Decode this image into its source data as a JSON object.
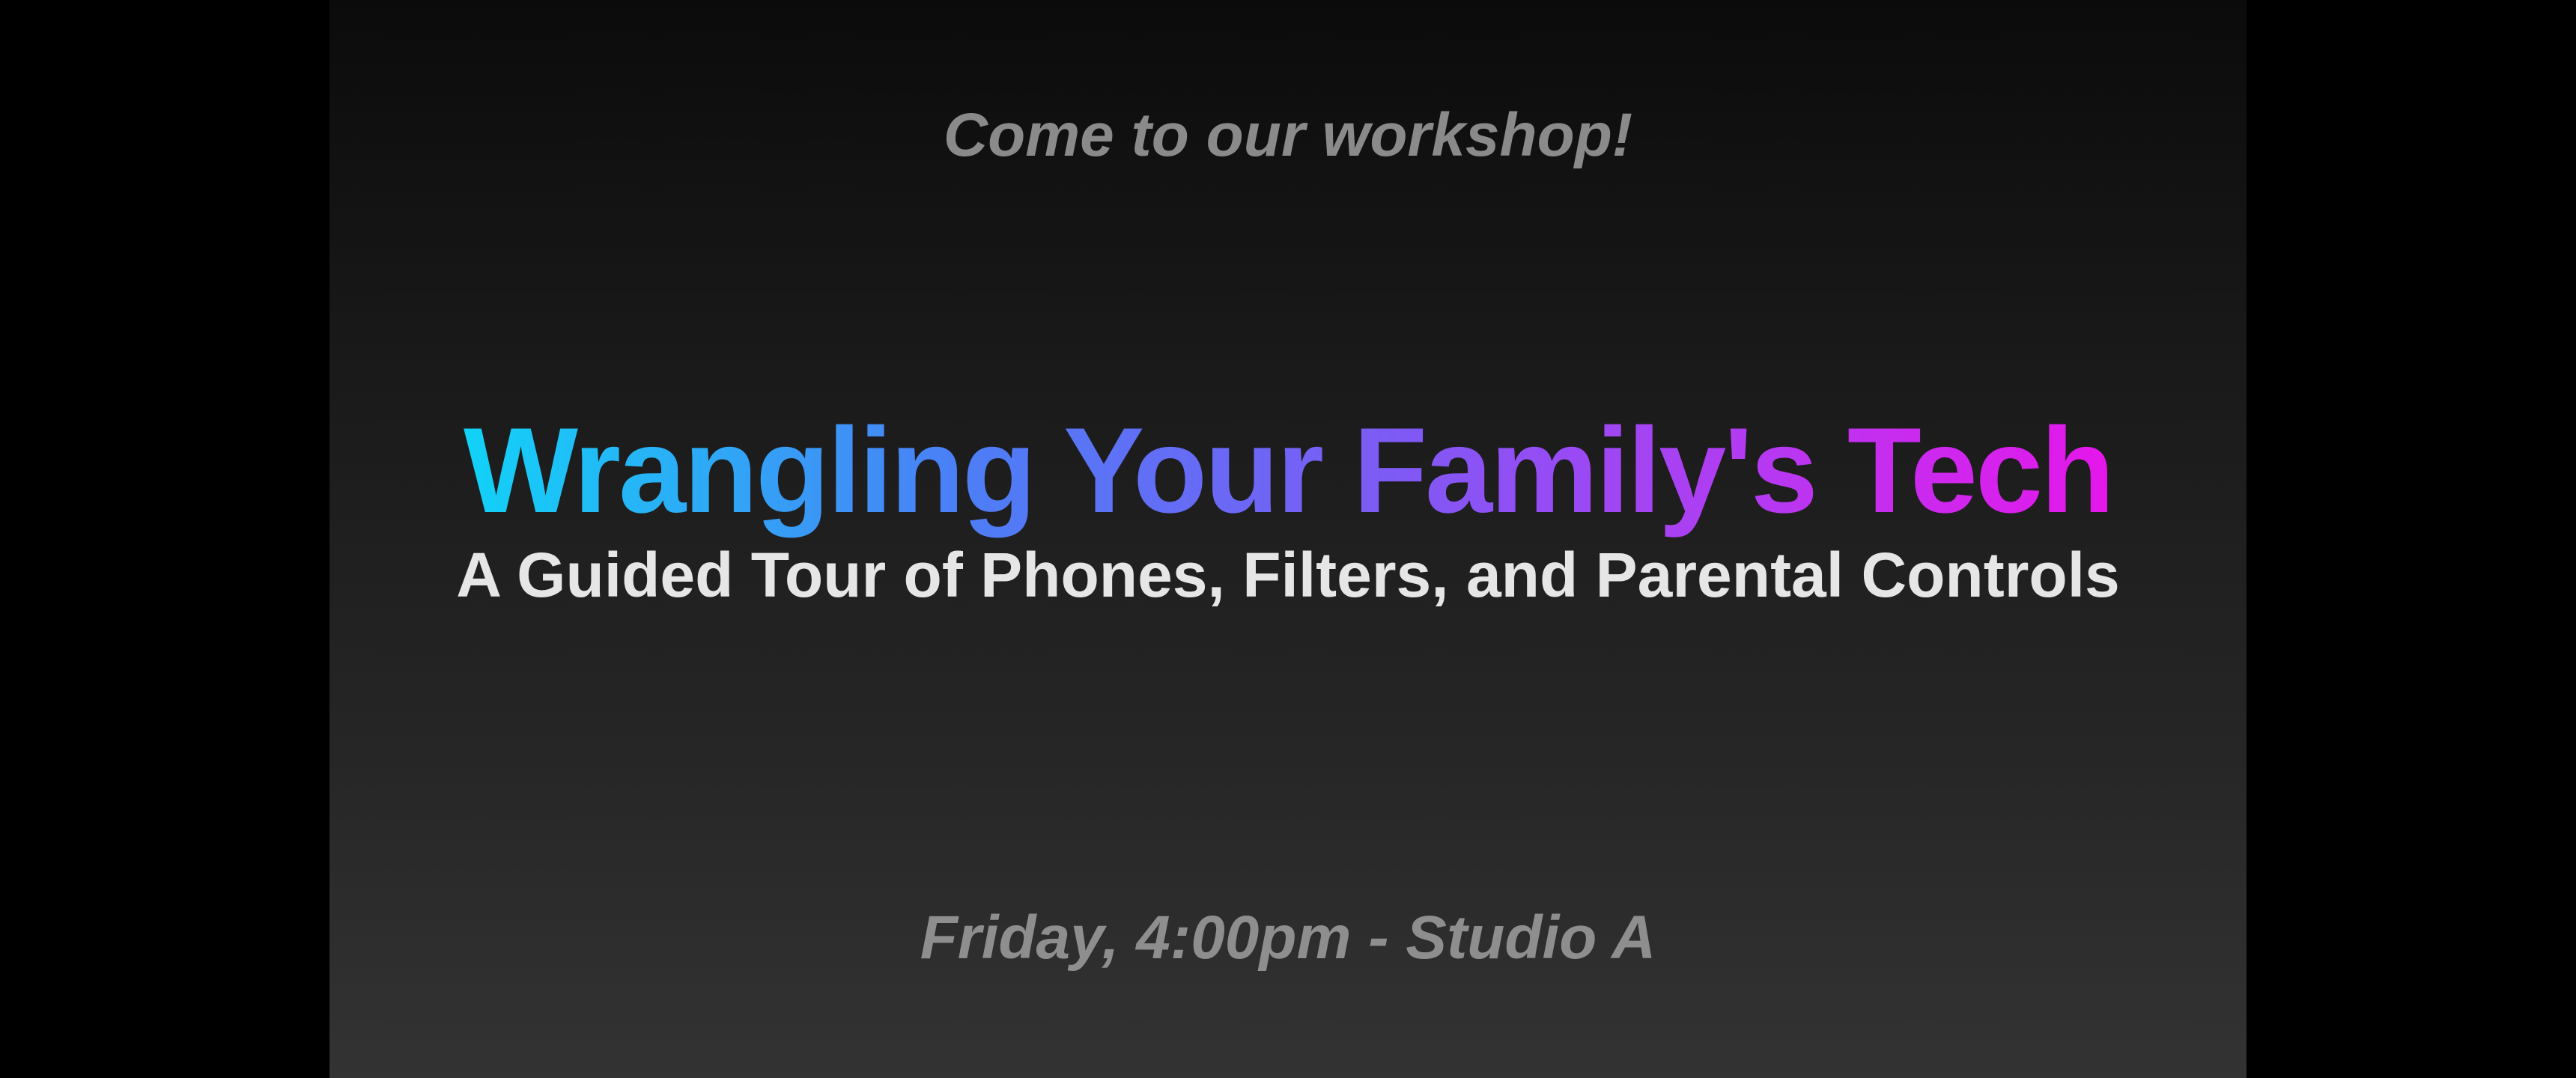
{
  "slide": {
    "intro": "Come to our workshop!",
    "title": "Wrangling Your Family's Tech",
    "subtitle": "A Guided Tour of Phones, Filters, and Parental Controls",
    "details": "Friday, 4:00pm - Studio A"
  },
  "colors": {
    "title_gradient_start": "#11d3f7",
    "title_gradient_end": "#e616ea",
    "subtitle": "#e6e6e6",
    "muted_text": "#8a8a8a",
    "background_top": "#0b0b0b",
    "background_bottom": "#333333",
    "letterbox": "#000000"
  }
}
